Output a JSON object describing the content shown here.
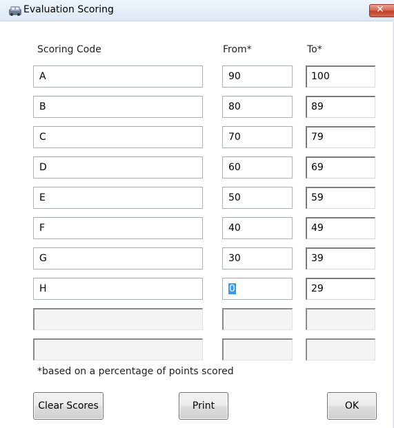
{
  "window": {
    "title": "Evaluation Scoring",
    "close_glyph": "✕",
    "icon": "app-icon"
  },
  "headers": {
    "code": "Scoring Code",
    "from": "From*",
    "to": "To*"
  },
  "rows": [
    {
      "code": "A",
      "from": "90",
      "to": "100"
    },
    {
      "code": "B",
      "from": "80",
      "to": "89"
    },
    {
      "code": "C",
      "from": "70",
      "to": "79"
    },
    {
      "code": "D",
      "from": "60",
      "to": "69"
    },
    {
      "code": "E",
      "from": "50",
      "to": "59"
    },
    {
      "code": "F",
      "from": "40",
      "to": "49"
    },
    {
      "code": "G",
      "from": "30",
      "to": "39"
    },
    {
      "code": "H",
      "from": "0",
      "to": "29"
    },
    {
      "code": "",
      "from": "",
      "to": ""
    },
    {
      "code": "",
      "from": "",
      "to": ""
    }
  ],
  "footnote": "*based on a percentage of points scored",
  "buttons": {
    "clear": "Clear Scores",
    "print": "Print",
    "ok": "OK"
  },
  "colors": {
    "selection": "#3399ff",
    "close_button": "#c94a35"
  }
}
